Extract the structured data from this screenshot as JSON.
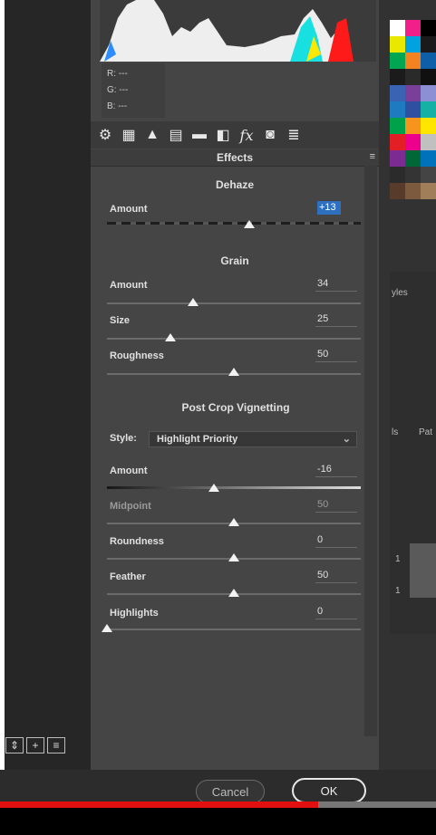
{
  "readout": {
    "r": "R:  ---",
    "g": "G:  ---",
    "b": "B:  ---"
  },
  "tab_icons": [
    "gear-icon",
    "tone-curve-icon",
    "detail-icon",
    "hsl-icon",
    "split-tone-icon",
    "lens-icon",
    "fx-icon",
    "camera-icon",
    "presets-icon"
  ],
  "tab_glyphs": [
    "⚙",
    "▦",
    "▲",
    "▤",
    "▬",
    "◧",
    "fx",
    "◙",
    "≣"
  ],
  "panel": {
    "title": "Effects",
    "menu": "≡"
  },
  "dehaze": {
    "title": "Dehaze",
    "amount": {
      "label": "Amount",
      "value": "+13",
      "level": 0.56
    }
  },
  "grain": {
    "title": "Grain",
    "amount": {
      "label": "Amount",
      "value": "34",
      "level": 0.34
    },
    "size": {
      "label": "Size",
      "value": "25",
      "level": 0.25
    },
    "roughness": {
      "label": "Roughness",
      "value": "50",
      "level": 0.5
    }
  },
  "vignette": {
    "title": "Post Crop Vignetting",
    "style_label": "Style:",
    "style_value": "Highlight Priority",
    "amount": {
      "label": "Amount",
      "value": "-16",
      "level": 0.42
    },
    "midpoint": {
      "label": "Midpoint",
      "value": "50",
      "level": 0.5
    },
    "roundness": {
      "label": "Roundness",
      "value": "0",
      "level": 0.5
    },
    "feather": {
      "label": "Feather",
      "value": "50",
      "level": 0.5
    },
    "highlights": {
      "label": "Highlights",
      "value": "0",
      "level": 0.0
    }
  },
  "buttons": {
    "cancel": "Cancel",
    "ok": "OK"
  },
  "right_panel": {
    "styles_tab": "yles",
    "paths_tab": "Pat",
    "layers_tab": "ls",
    "row1": "1",
    "row2": "1"
  },
  "video": {
    "progress": 0.73
  },
  "swatch_colors": [
    "#ffffff",
    "#f21e8a",
    "#000000",
    "#e8e800",
    "#00a3e0",
    "#1a1a1a",
    "#00a651",
    "#f58220",
    "#0f5fa8",
    "#1b1b1b",
    "#2a2a2a",
    "#101010",
    "#3a63b4",
    "#7a3f99",
    "#8c8fd4",
    "#1f7bc1",
    "#2f4fa0",
    "#16b1a5",
    "#00a14b",
    "#f7941d",
    "#ffe600",
    "#e31e24",
    "#ed008c",
    "#c0c0c0",
    "#7b2b92",
    "#006837",
    "#0072bc",
    "#2b2b2b",
    "#343434",
    "#444444",
    "#593b2c",
    "#7c5a3e",
    "#a07e5a"
  ]
}
